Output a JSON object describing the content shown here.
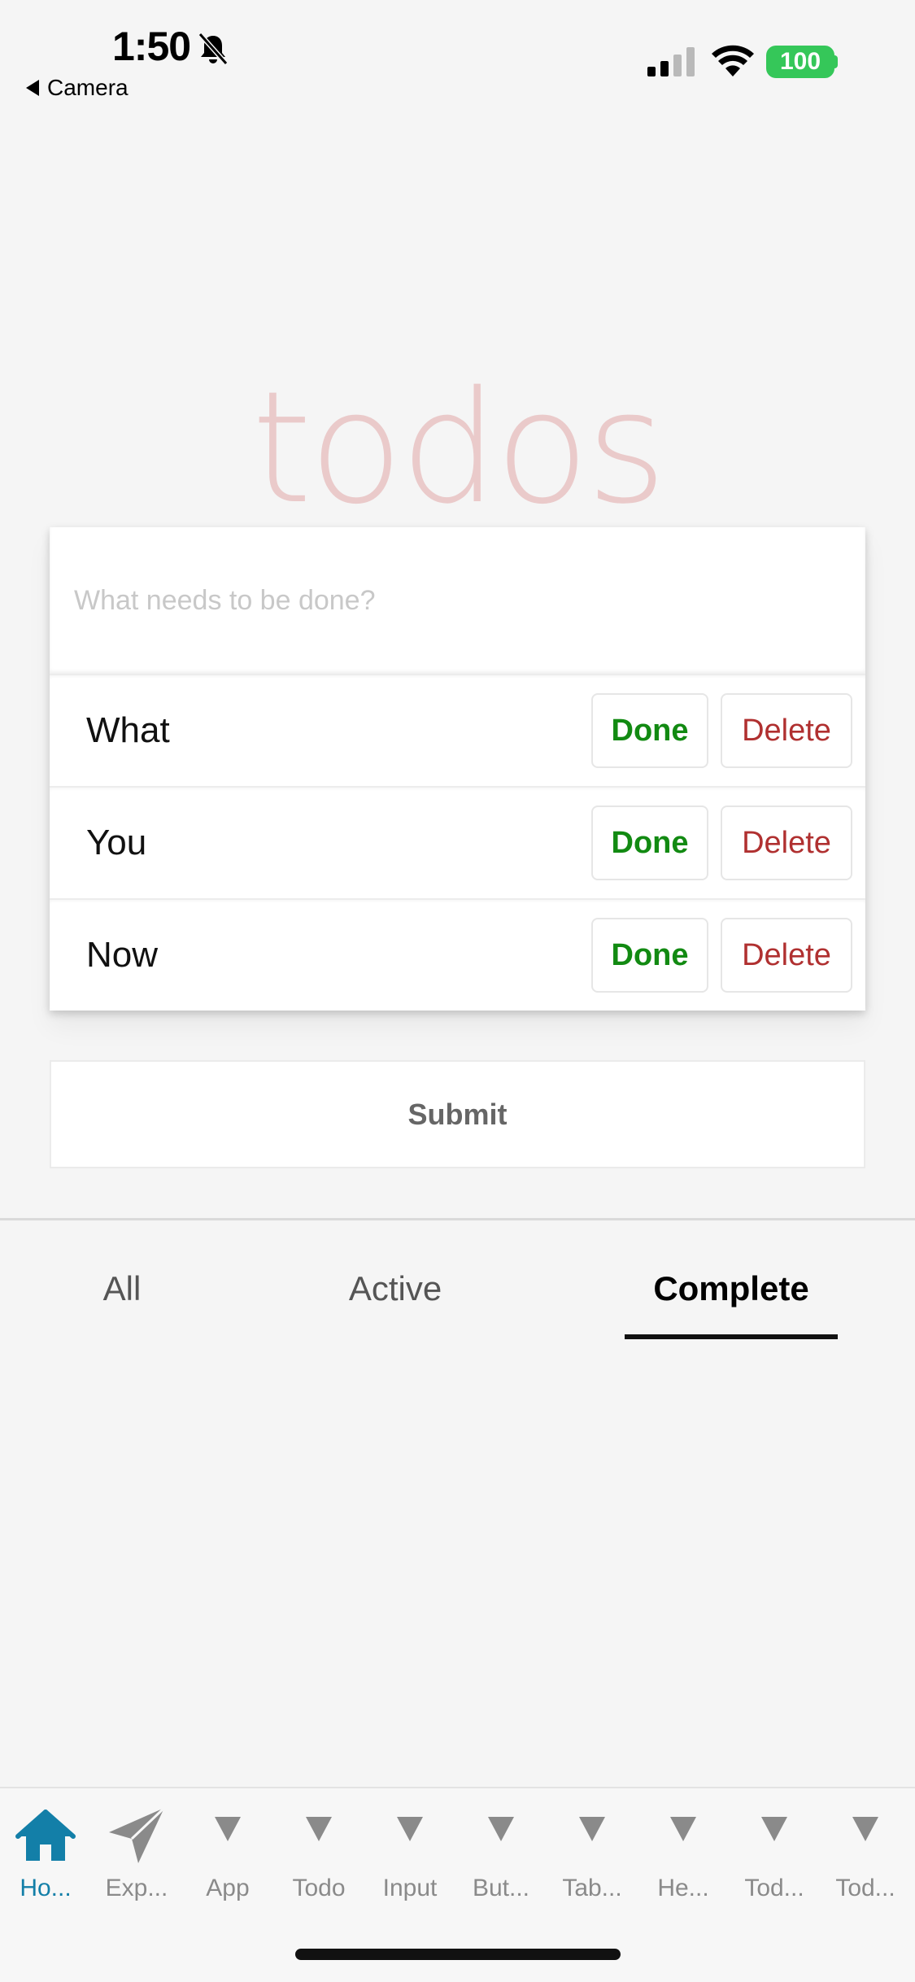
{
  "status_bar": {
    "time": "1:50",
    "back_label": "Camera",
    "battery": "100"
  },
  "title": "todos",
  "new_todo": {
    "placeholder": "What needs to be done?",
    "value": ""
  },
  "todos": [
    {
      "text": "What",
      "done_label": "Done",
      "delete_label": "Delete"
    },
    {
      "text": "You",
      "done_label": "Done",
      "delete_label": "Delete"
    },
    {
      "text": "Now",
      "done_label": "Done",
      "delete_label": "Delete"
    }
  ],
  "submit_label": "Submit",
  "filters": {
    "all": "All",
    "active": "Active",
    "complete": "Complete",
    "selected": "complete"
  },
  "tab_bar": [
    {
      "label": "Ho...",
      "icon": "home-icon",
      "active": true
    },
    {
      "label": "Exp...",
      "icon": "paper-plane-icon",
      "active": false
    },
    {
      "label": "App",
      "icon": "triangle-down-icon",
      "active": false
    },
    {
      "label": "Todo",
      "icon": "triangle-down-icon",
      "active": false
    },
    {
      "label": "Input",
      "icon": "triangle-down-icon",
      "active": false
    },
    {
      "label": "But...",
      "icon": "triangle-down-icon",
      "active": false
    },
    {
      "label": "Tab...",
      "icon": "triangle-down-icon",
      "active": false
    },
    {
      "label": "He...",
      "icon": "triangle-down-icon",
      "active": false
    },
    {
      "label": "Tod...",
      "icon": "triangle-down-icon",
      "active": false
    },
    {
      "label": "Tod...",
      "icon": "triangle-down-icon",
      "active": false
    }
  ],
  "colors": {
    "background": "#f5f5f5",
    "title": "#eacaca",
    "done": "#128a12",
    "delete": "#b03030",
    "tab_active": "#137fa8",
    "battery": "#35c759"
  }
}
